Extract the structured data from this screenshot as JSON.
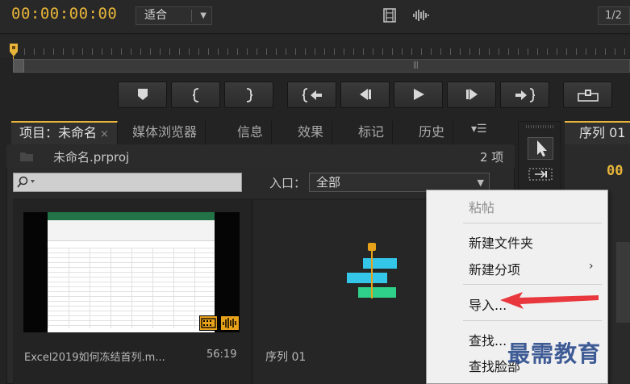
{
  "monitor": {
    "timecode": "00:00:00:00",
    "zoom": "适合",
    "page_indicator": "1/2"
  },
  "panel": {
    "tabs": [
      {
        "label": "项目：未命名"
      },
      {
        "label": "媒体浏览器"
      },
      {
        "label": "信息"
      },
      {
        "label": "效果"
      },
      {
        "label": "标记"
      },
      {
        "label": "历史"
      }
    ],
    "project_file": "未命名.prproj",
    "item_count": "2 项",
    "entry_label": "入口：",
    "entry_value": "全部"
  },
  "bin": {
    "clip": {
      "name": "Excel2019如何冻结首列.m...",
      "duration": "56:19"
    },
    "sequence": {
      "name": "序列 01"
    }
  },
  "sequence_panel": {
    "tab": "序列 01",
    "timecode": "00"
  },
  "context_menu": {
    "items": [
      {
        "label": "粘帖",
        "enabled": false
      },
      {
        "label": "新建文件夹",
        "enabled": true
      },
      {
        "label": "新建分项",
        "enabled": true,
        "submenu_glyph": "›"
      },
      {
        "label": "导入...",
        "enabled": true
      },
      {
        "label": "查找...",
        "enabled": true
      },
      {
        "label": "查找脸部",
        "enabled": true
      }
    ]
  },
  "watermark": "最需教育",
  "colors": {
    "accent": "#e8b53a",
    "annotation_arrow": "#e8383d",
    "sequence_icon_cyan": "#34c6e8",
    "sequence_icon_green": "#2fd08a"
  }
}
